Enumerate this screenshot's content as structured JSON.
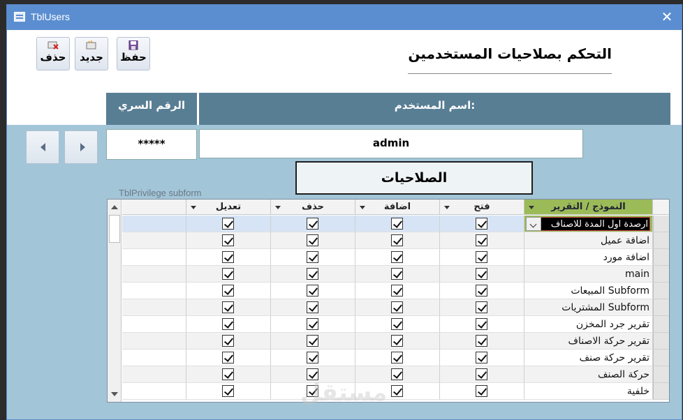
{
  "window": {
    "title": "TblUsers",
    "close_glyph": "✕"
  },
  "toolbar": {
    "delete_label": "حذف",
    "new_label": "جديد",
    "save_label": "حفظ"
  },
  "form": {
    "title": "التحكم بصلاحيات المستخدمين",
    "password_header": "الرقم السري",
    "username_header": "اسم المستخدم:",
    "password_value": "*****",
    "username_value": "admin",
    "privileges_title": "الصلاحيات",
    "subform_label": "TblPrivilege subform"
  },
  "grid": {
    "columns": [
      "النموذج / التقرير",
      "فتح",
      "اضافة",
      "حذف",
      "تعديل"
    ],
    "rows": [
      {
        "name": "ارصدة اول المدة للاصناف",
        "open": true,
        "add": true,
        "delete": true,
        "edit": true
      },
      {
        "name": "اضافة عميل",
        "open": true,
        "add": true,
        "delete": true,
        "edit": true
      },
      {
        "name": "اضافة مورد",
        "open": true,
        "add": true,
        "delete": true,
        "edit": true
      },
      {
        "name": "main",
        "open": true,
        "add": true,
        "delete": true,
        "edit": true
      },
      {
        "name": "Subform المبيعات",
        "open": true,
        "add": true,
        "delete": true,
        "edit": true
      },
      {
        "name": "Subform المشتريات",
        "open": true,
        "add": true,
        "delete": true,
        "edit": true
      },
      {
        "name": "تقرير جرد المخزن",
        "open": true,
        "add": true,
        "delete": true,
        "edit": true
      },
      {
        "name": "تقرير حركة الاصناف",
        "open": true,
        "add": true,
        "delete": true,
        "edit": true
      },
      {
        "name": "تقرير حركة صنف",
        "open": true,
        "add": true,
        "delete": true,
        "edit": true
      },
      {
        "name": "حركة الصنف",
        "open": true,
        "add": true,
        "delete": true,
        "edit": true
      },
      {
        "name": "خلفية",
        "open": true,
        "add": true,
        "delete": true,
        "edit": true
      }
    ]
  },
  "watermark": "مستقل",
  "colors": {
    "title_bar": "#5b8ed1",
    "header_band": "#587e94",
    "body": "#a3c5d8",
    "name_header": "#9bbb59"
  }
}
